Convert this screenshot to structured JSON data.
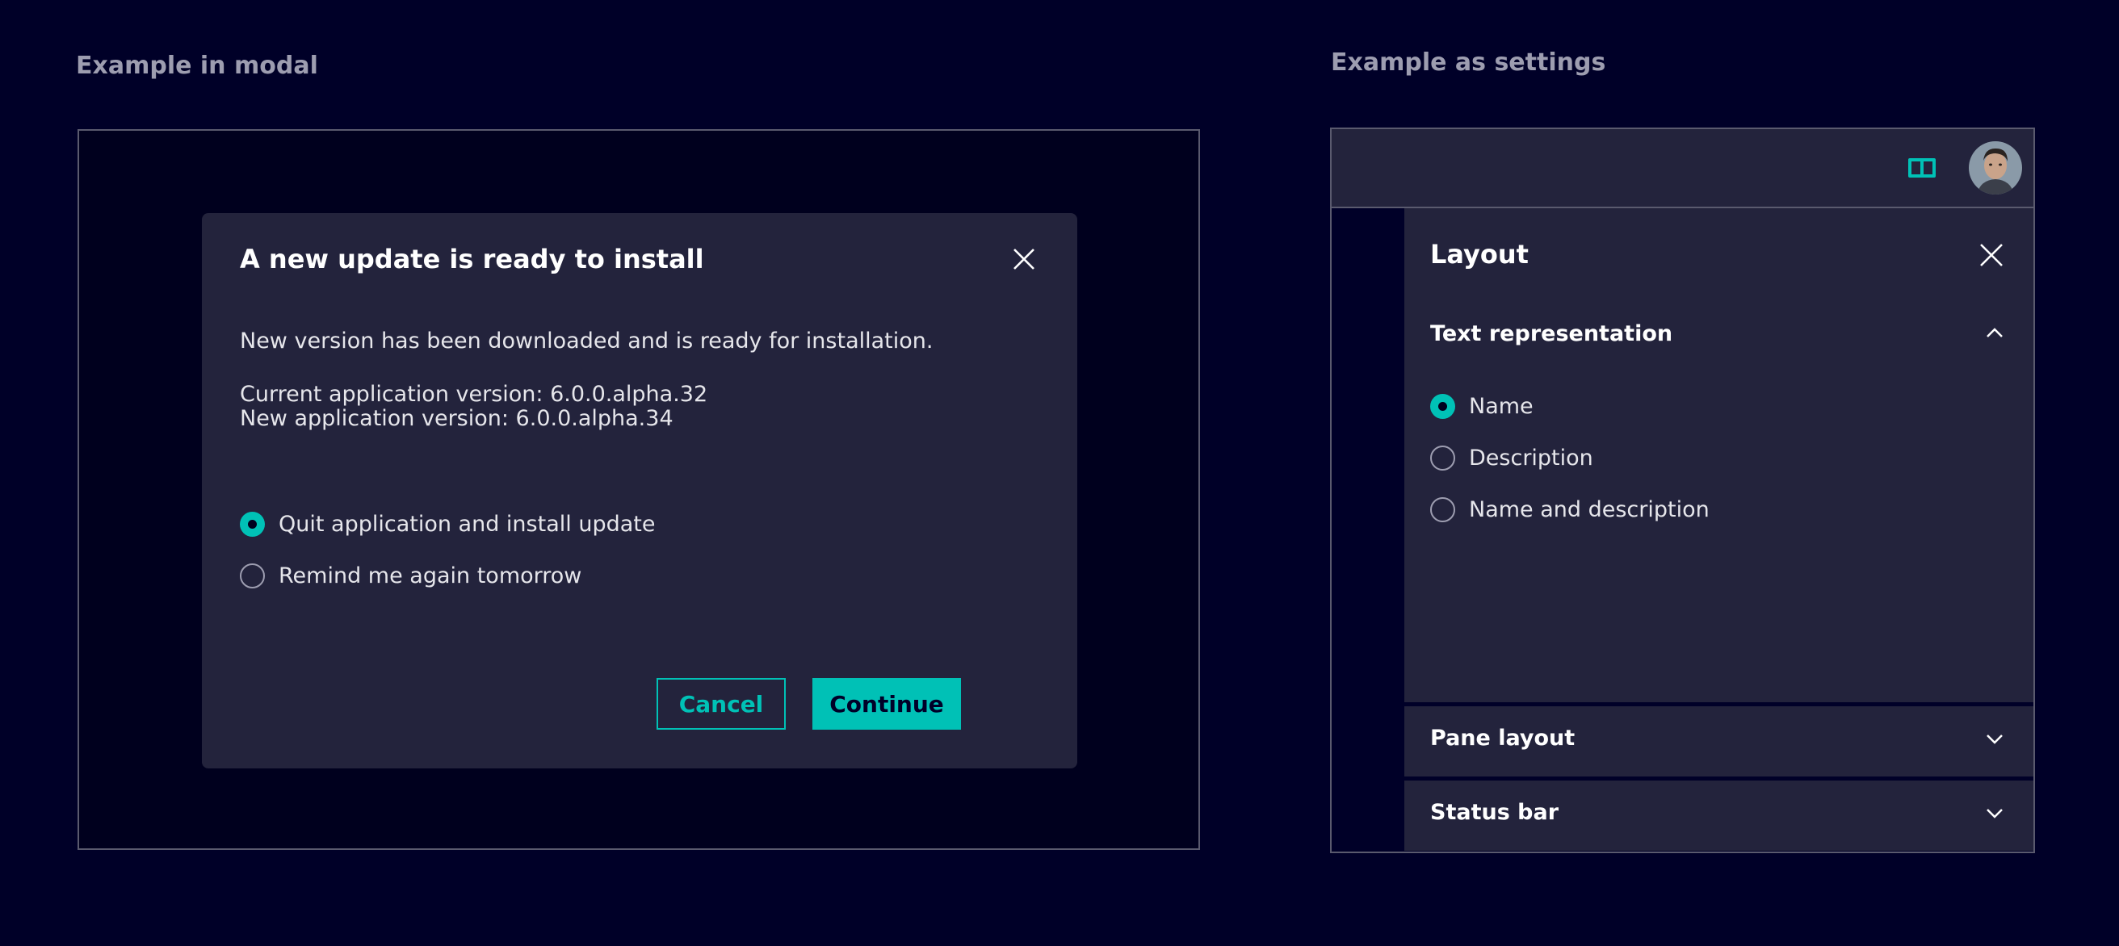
{
  "labels": {
    "modal_example": "Example in modal",
    "settings_example": "Example as settings"
  },
  "dialog": {
    "title": "A new update is ready to install",
    "message": "New version has been downloaded and is ready for installation.",
    "current_version": "Current application version: 6.0.0.alpha.32",
    "new_version": "New application version: 6.0.0.alpha.34",
    "options": [
      {
        "label": "Quit application and install update",
        "checked": true
      },
      {
        "label": "Remind me again tomorrow",
        "checked": false
      }
    ],
    "cancel_label": "Cancel",
    "continue_label": "Continue"
  },
  "settings": {
    "title": "Layout",
    "sections": [
      {
        "title": "Text representation",
        "expanded": true
      },
      {
        "title": "Pane layout",
        "expanded": false
      },
      {
        "title": "Status bar",
        "expanded": false
      }
    ],
    "text_options": [
      {
        "label": "Name",
        "checked": true
      },
      {
        "label": "Description",
        "checked": false
      },
      {
        "label": "Name and description",
        "checked": false
      }
    ]
  },
  "icons": {
    "close": "close-icon",
    "chevron_up": "chevron-up-icon",
    "chevron_down": "chevron-down-icon",
    "layout_toggle": "layout-icon",
    "avatar": "avatar"
  },
  "colors": {
    "background": "#000028",
    "surface": "#23233c",
    "accent": "#00c1b6",
    "text_muted": "#9d9db0"
  }
}
